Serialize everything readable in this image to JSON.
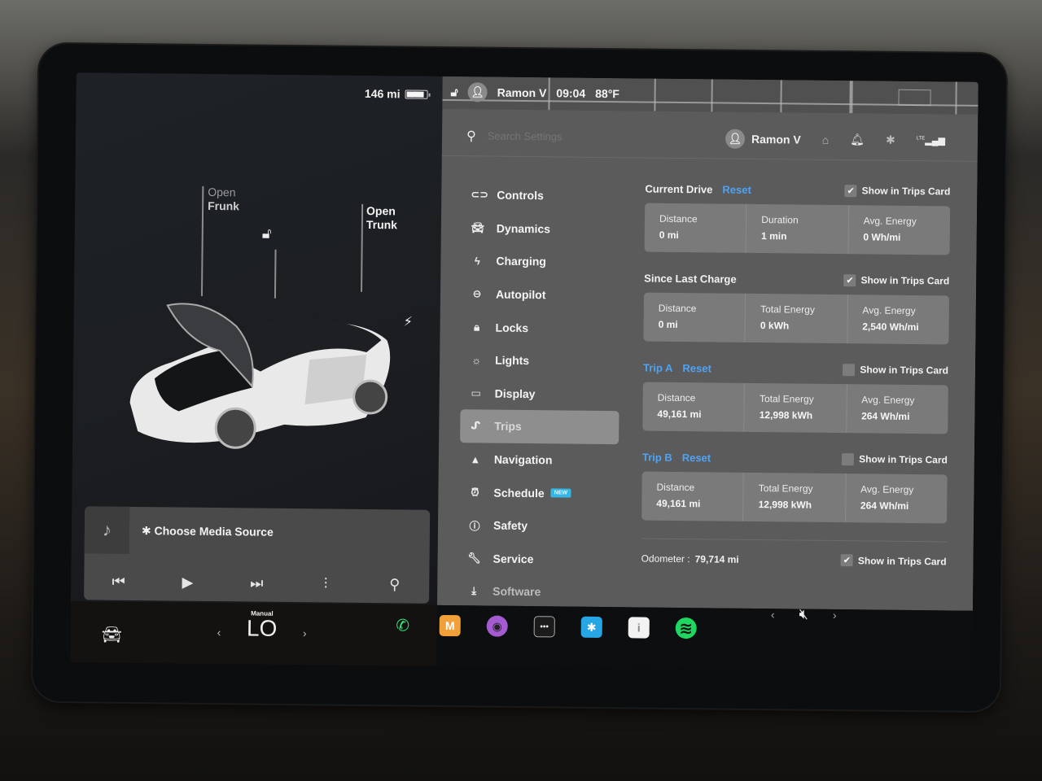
{
  "car_panel": {
    "range": "146 mi",
    "battery_level_pct": 80,
    "frunk": {
      "action": "Open",
      "label": "Frunk"
    },
    "trunk": {
      "action": "Open",
      "label": "Trunk"
    },
    "lock_icon": "unlocked-icon",
    "charge_port_icon": "bolt-icon"
  },
  "media": {
    "source_label": "Choose Media Source",
    "source_icon": "bluetooth-icon",
    "controls": [
      "previous",
      "play",
      "next",
      "equalizer",
      "search"
    ]
  },
  "status_bar": {
    "user": "Ramon V",
    "time": "09:04",
    "temperature": "88°F"
  },
  "search": {
    "placeholder": "Search Settings"
  },
  "header": {
    "user": "Ramon V",
    "icons": [
      "garage-icon",
      "bell-icon",
      "bluetooth-icon",
      "lte-signal-icon"
    ],
    "lte_label": "LTE"
  },
  "nav": {
    "items": [
      {
        "label": "Controls",
        "icon": "toggle-icon"
      },
      {
        "label": "Dynamics",
        "icon": "car-icon"
      },
      {
        "label": "Charging",
        "icon": "bolt-icon"
      },
      {
        "label": "Autopilot",
        "icon": "steering-wheel-icon"
      },
      {
        "label": "Locks",
        "icon": "lock-icon"
      },
      {
        "label": "Lights",
        "icon": "sun-icon"
      },
      {
        "label": "Display",
        "icon": "display-icon"
      },
      {
        "label": "Trips",
        "icon": "trips-icon",
        "active": true
      },
      {
        "label": "Navigation",
        "icon": "navigation-icon"
      },
      {
        "label": "Schedule",
        "icon": "alarm-icon",
        "badge": "NEW"
      },
      {
        "label": "Safety",
        "icon": "safety-icon"
      },
      {
        "label": "Service",
        "icon": "wrench-icon"
      },
      {
        "label": "Software",
        "icon": "download-icon"
      }
    ]
  },
  "trips": {
    "show_in_trips_card_label": "Show in Trips Card",
    "reset_label": "Reset",
    "current_drive": {
      "title": "Current Drive",
      "show": true,
      "cells": [
        {
          "label": "Distance",
          "value": "0 mi"
        },
        {
          "label": "Duration",
          "value": "1 min"
        },
        {
          "label": "Avg. Energy",
          "value": "0 Wh/mi"
        }
      ]
    },
    "since_last_charge": {
      "title": "Since Last Charge",
      "show": true,
      "cells": [
        {
          "label": "Distance",
          "value": "0 mi"
        },
        {
          "label": "Total Energy",
          "value": "0 kWh"
        },
        {
          "label": "Avg. Energy",
          "value": "2,540 Wh/mi"
        }
      ]
    },
    "trip_a": {
      "title": "Trip A",
      "show": false,
      "cells": [
        {
          "label": "Distance",
          "value": "49,161 mi"
        },
        {
          "label": "Total Energy",
          "value": "12,998 kWh"
        },
        {
          "label": "Avg. Energy",
          "value": "264 Wh/mi"
        }
      ]
    },
    "trip_b": {
      "title": "Trip B",
      "show": false,
      "cells": [
        {
          "label": "Distance",
          "value": "49,161 mi"
        },
        {
          "label": "Total Energy",
          "value": "12,998 kWh"
        },
        {
          "label": "Avg. Energy",
          "value": "264 Wh/mi"
        }
      ]
    },
    "odometer": {
      "label": "Odometer :",
      "value": "79,714 mi",
      "show": true
    }
  },
  "bottom_bar": {
    "climate_mode": "Manual",
    "climate_value": "LO",
    "apps": [
      {
        "name": "phone",
        "glyph": "✆",
        "color": "#2ee87a"
      },
      {
        "name": "toybox",
        "glyph": "M",
        "color": "#f2a13a"
      },
      {
        "name": "camera",
        "glyph": "◉",
        "color": "#a45bd0"
      },
      {
        "name": "more",
        "glyph": "•••",
        "color": "#1b1b1b"
      },
      {
        "name": "bluetooth",
        "glyph": "✱",
        "color": "#27a6e6"
      },
      {
        "name": "release-notes",
        "glyph": "i",
        "color": "#f2f2f2"
      },
      {
        "name": "spotify",
        "glyph": "≋",
        "color": "#1ed760"
      }
    ],
    "volume_muted": true
  }
}
